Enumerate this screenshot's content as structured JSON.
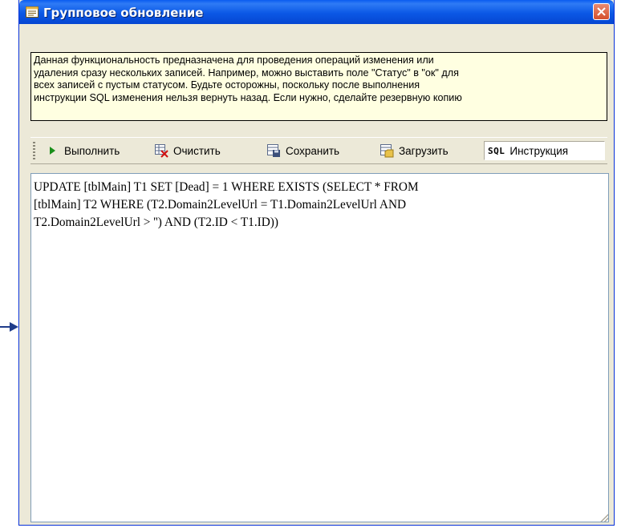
{
  "window": {
    "title": "Групповое обновление",
    "title_icon": "form-grid-icon",
    "close_icon": "close-icon"
  },
  "info": {
    "lines": [
      "Данная функциональность предназначена для проведения операций изменения или",
      "удаления сразу нескольких записей. Например, можно выставить поле \"Статус\" в \"ок\" для",
      "всех записей с пустым статусом. Будьте осторожны, поскольку после выполнения",
      "инструкции SQL изменения нельзя вернуть назад. Если нужно, сделайте резервную копию"
    ]
  },
  "toolbar": {
    "run_label": "Выполнить",
    "clear_label": "Очистить",
    "save_label": "Сохранить",
    "load_label": "Загрузить",
    "sql_badge": "SQL",
    "sql_label": "Инструкция",
    "icons": {
      "run": "play-icon",
      "clear": "clear-icon",
      "save": "save-icon",
      "load": "load-icon"
    }
  },
  "editor": {
    "lines": [
      "UPDATE [tblMain] T1 SET [Dead] = 1 WHERE EXISTS (SELECT * FROM",
      "[tblMain] T2 WHERE (T2.Domain2LevelUrl = T1.Domain2LevelUrl AND",
      "T2.Domain2LevelUrl > '') AND (T2.ID < T1.ID))"
    ]
  },
  "colors": {
    "titlebar": "#0b58e6",
    "window_bg": "#ece9d8",
    "info_bg": "#ffffe1",
    "run_icon": "#1a8f1a",
    "close_button": "#d5502d",
    "pointer_arrow": "#1f3c8a"
  }
}
